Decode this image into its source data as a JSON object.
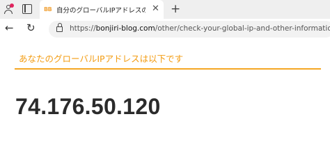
{
  "browser": {
    "tab": {
      "favicon_text": "BB",
      "title": "自分のグローバルIPアドレスの確認",
      "close_glyph": "✕"
    },
    "new_tab_glyph": "+",
    "url_prefix": "https://",
    "url_domain": "bonjiri-blog.com",
    "url_path": "/other/check-your-global-ip-and-other-information/",
    "icons": [
      "profile-icon",
      "tab-actions-icon",
      "back-icon",
      "reload-icon",
      "lock-icon"
    ]
  },
  "page": {
    "heading": "あなたのグローバルIPアドレスは以下です",
    "ip_address": "74.176.50.120"
  },
  "colors": {
    "accent": "#f39c12",
    "rule": "#f5a623",
    "notification_dot": "#e0245e"
  }
}
